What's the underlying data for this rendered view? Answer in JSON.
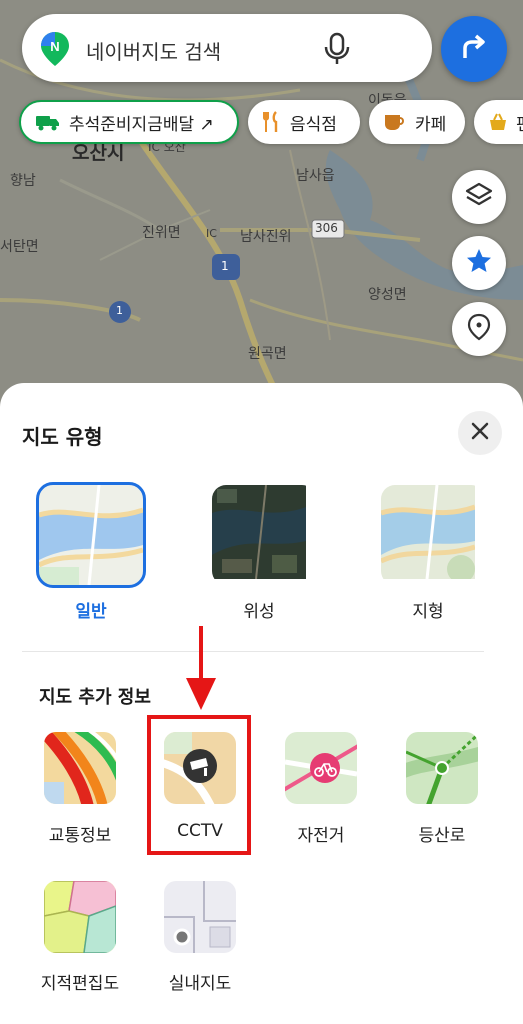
{
  "search": {
    "placeholder_text": "네이버지도 검색"
  },
  "chips": [
    {
      "label": "추석준비지금배달 ↗"
    },
    {
      "label": "음식점"
    },
    {
      "label": "카페"
    },
    {
      "label": "편"
    }
  ],
  "map_labels": {
    "ojeong": "오산시",
    "hyangnam": "향남",
    "seotan": "서탄면",
    "jinwi": "진위면",
    "namsajinwi": "남사진위",
    "namsaeup": "남사읍",
    "yangseong": "양성면",
    "wongok": "원곡면",
    "idong": "이동읍",
    "ic_osan": "IC 오산",
    "road_306": "306",
    "route_1": "1",
    "route_1b": "1",
    "ic_label": "IC"
  },
  "sheet": {
    "title": "지도 유형",
    "map_types": [
      {
        "label": "일반",
        "selected": true
      },
      {
        "label": "위성",
        "selected": false
      },
      {
        "label": "지형",
        "selected": false
      }
    ],
    "extra_title": "지도 추가 정보",
    "extra_items": [
      {
        "label": "교통정보"
      },
      {
        "label": "CCTV"
      },
      {
        "label": "자전거"
      },
      {
        "label": "등산로"
      },
      {
        "label": "지적편집도"
      },
      {
        "label": "실내지도"
      }
    ]
  },
  "colors": {
    "accent": "#1d6fe0",
    "highlight": "#e51616",
    "chip_green": "#0fa04a"
  }
}
